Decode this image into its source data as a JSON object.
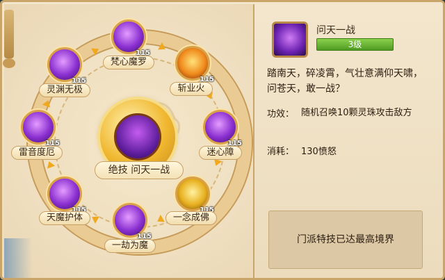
{
  "center": {
    "label": "绝技  问天一战"
  },
  "skills": [
    {
      "name": "梵心魔罗",
      "level": "115"
    },
    {
      "name": "斩业火",
      "level": "115"
    },
    {
      "name": "迷心障",
      "level": "115"
    },
    {
      "name": "一念成佛",
      "level": "115"
    },
    {
      "name": "一劫为魔",
      "level": "115"
    },
    {
      "name": "天魔护体",
      "level": "115"
    },
    {
      "name": "雷音度厄",
      "level": "115"
    },
    {
      "name": "灵渊无极",
      "level": "115"
    }
  ],
  "detail": {
    "title": "问天一战",
    "level": "3级",
    "description": "踏南天，碎凌霄，气壮意满仰天啸，问苍天，敢一战？",
    "effect_label": "功效：",
    "effect_value": "随机召唤10颗灵珠攻击敌方",
    "cost_label": "消耗：",
    "cost_value": "130愤怒",
    "status": "门派特技已达最高境界"
  },
  "colors": {
    "accent": "#f0a81e",
    "level_bar": "#5fae2c",
    "panel": "#f1e3c6"
  }
}
